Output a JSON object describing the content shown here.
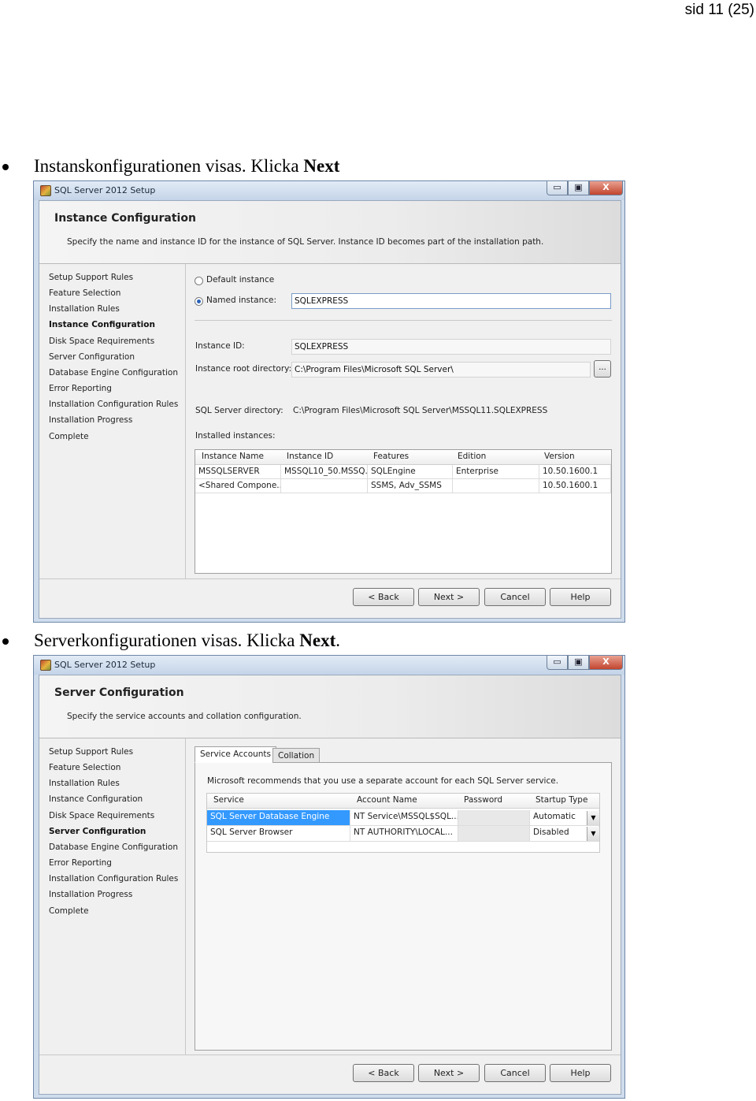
{
  "page_number": "sid 11 (25)",
  "bullet1": {
    "text": "Instanskonfigurationen visas. Klicka ",
    "bold": "Next",
    "after": ""
  },
  "bullet2": {
    "text": "Serverkonfigurationen visas. Klicka ",
    "bold": "Next",
    "after": "."
  },
  "window1": {
    "title": "SQL Server 2012 Setup",
    "controls": {
      "minimize": "▭",
      "maximize": "▣",
      "close": "X"
    },
    "header_title": "Instance Configuration",
    "header_sub": "Specify the name and instance ID for the instance of SQL Server. Instance ID becomes part of the installation path.",
    "nav": [
      "Setup Support Rules",
      "Feature Selection",
      "Installation Rules",
      "Instance Configuration",
      "Disk Space Requirements",
      "Server Configuration",
      "Database Engine Configuration",
      "Error Reporting",
      "Installation Configuration Rules",
      "Installation Progress",
      "Complete"
    ],
    "nav_active": "Instance Configuration",
    "default_instance_label": "Default instance",
    "named_instance_label": "Named instance:",
    "named_instance_value": "SQLEXPRESS",
    "instance_id_label": "Instance ID:",
    "instance_id_value": "SQLEXPRESS",
    "root_dir_label": "Instance root directory:",
    "root_dir_value": "C:\\Program Files\\Microsoft SQL Server\\",
    "browse_label": "...",
    "sql_dir_label": "SQL Server directory:",
    "sql_dir_value": "C:\\Program Files\\Microsoft SQL Server\\MSSQL11.SQLEXPRESS",
    "installed_label": "Installed instances:",
    "columns": [
      "Instance Name",
      "Instance ID",
      "Features",
      "Edition",
      "Version"
    ],
    "rows": [
      [
        "MSSQLSERVER",
        "MSSQL10_50.MSSQ...",
        "SQLEngine",
        "Enterprise",
        "10.50.1600.1"
      ],
      [
        "<Shared Compone...",
        "",
        "SSMS, Adv_SSMS",
        "",
        "10.50.1600.1"
      ]
    ],
    "buttons": [
      "< Back",
      "Next >",
      "Cancel",
      "Help"
    ]
  },
  "window2": {
    "title": "SQL Server 2012 Setup",
    "controls": {
      "minimize": "▭",
      "maximize": "▣",
      "close": "X"
    },
    "header_title": "Server Configuration",
    "header_sub": "Specify the service accounts and collation configuration.",
    "nav": [
      "Setup Support Rules",
      "Feature Selection",
      "Installation Rules",
      "Instance Configuration",
      "Disk Space Requirements",
      "Server Configuration",
      "Database Engine Configuration",
      "Error Reporting",
      "Installation Configuration Rules",
      "Installation Progress",
      "Complete"
    ],
    "nav_active": "Server Configuration",
    "tabs": [
      "Service Accounts",
      "Collation"
    ],
    "recommend": "Microsoft recommends that you use a separate account for each SQL Server service.",
    "columns": [
      "Service",
      "Account Name",
      "Password",
      "Startup Type"
    ],
    "rows": [
      [
        "SQL Server Database Engine",
        "NT Service\\MSSQL$SQL...",
        "",
        "Automatic"
      ],
      [
        "SQL Server Browser",
        "NT AUTHORITY\\LOCAL...",
        "",
        "Disabled"
      ]
    ],
    "dropdown_glyph": "▼",
    "buttons": [
      "< Back",
      "Next >",
      "Cancel",
      "Help"
    ]
  }
}
